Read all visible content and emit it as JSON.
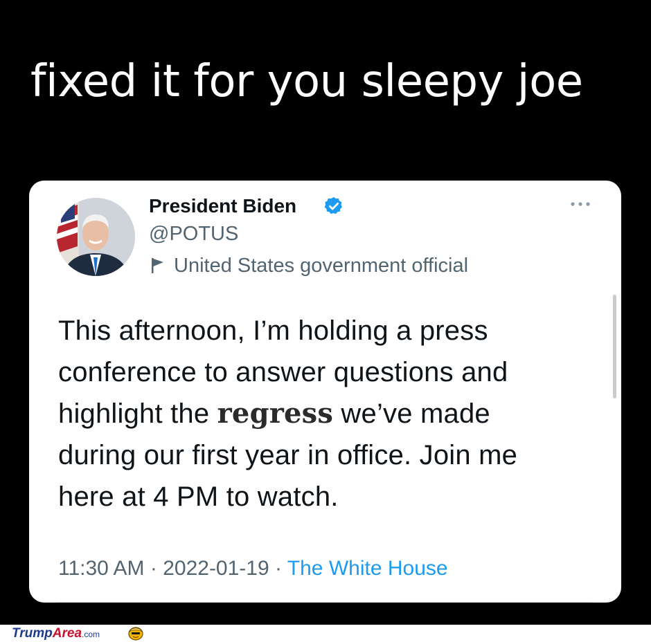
{
  "caption": "fixed it for you sleepy joe",
  "tweet": {
    "author_name": "President Biden",
    "author_handle": "@POTUS",
    "account_label": "United States government official",
    "body_lines": [
      "This afternoon, I’m holding a press",
      "conference to answer questions and"
    ],
    "body_line3_before": "highlight the ",
    "body_line3_highlight": "regress",
    "body_line3_after": " we’ve made",
    "body_lines_end": [
      "during our first year in office. Join me",
      "here at 4 PM to watch."
    ],
    "time": "11:30 AM",
    "separator": " · ",
    "date": "2022-01-19",
    "source": "The White House"
  },
  "footer": {
    "logo_part1": "Trump",
    "logo_part2": "Area",
    "logo_part3": ".com"
  },
  "icons": {
    "verified": "verified-badge-icon",
    "more": "more-options-icon",
    "flag": "government-flag-icon",
    "mascot": "mascot-icon"
  },
  "colors": {
    "background": "#000000",
    "card": "#ffffff",
    "verified_blue": "#1d9bf0",
    "secondary_text": "#536471",
    "source_link": "#1d9bf0"
  }
}
